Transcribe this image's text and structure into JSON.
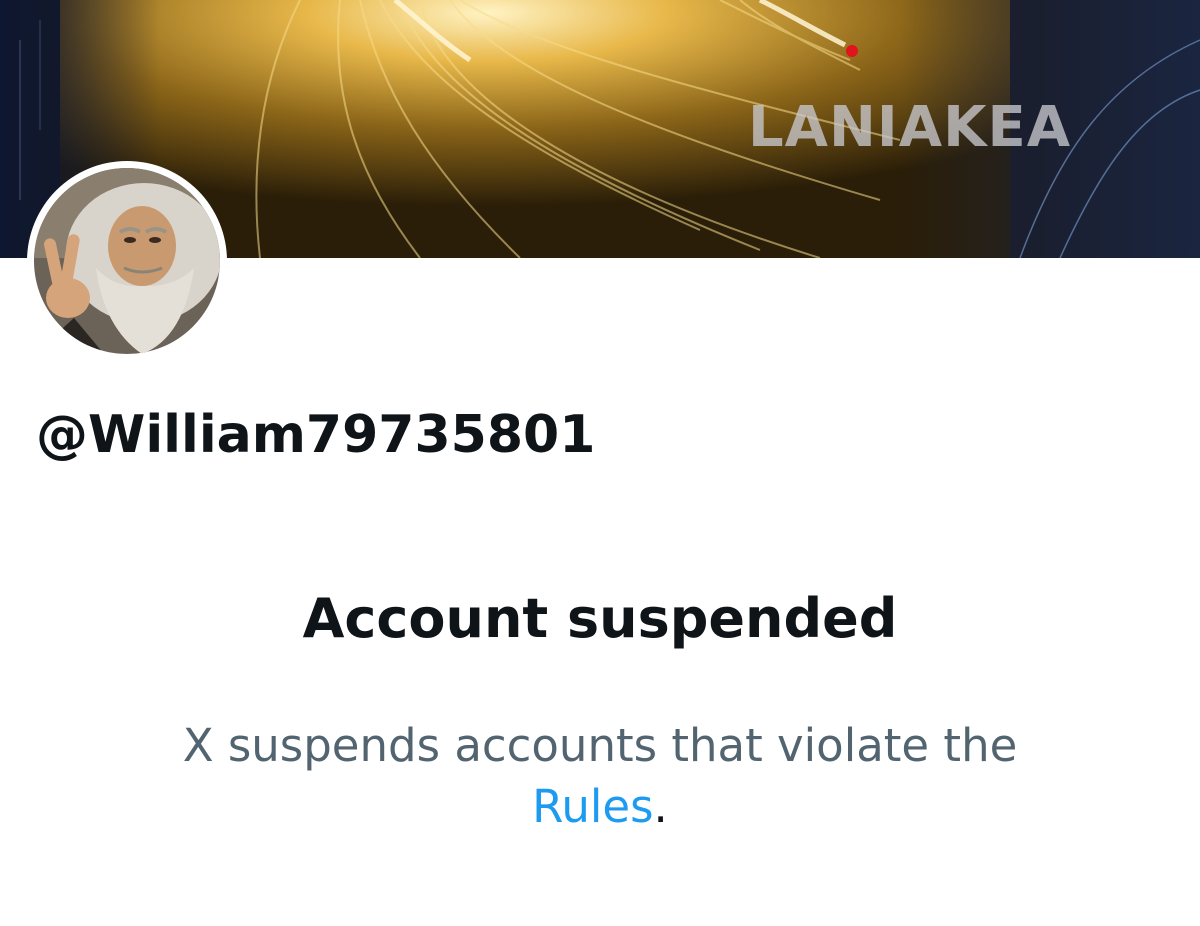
{
  "banner": {
    "overlay_text": "LANIAKEA",
    "accent_color": "#e8b84a",
    "marker_color": "#e0141c"
  },
  "profile": {
    "handle": "@William79735801"
  },
  "suspension": {
    "title": "Account suspended",
    "description": "X suspends accounts that violate the",
    "link_text": "Rules",
    "trailing": "."
  },
  "colors": {
    "primary_text": "#0f1419",
    "secondary_text": "#536471",
    "link": "#1d9bf0"
  }
}
